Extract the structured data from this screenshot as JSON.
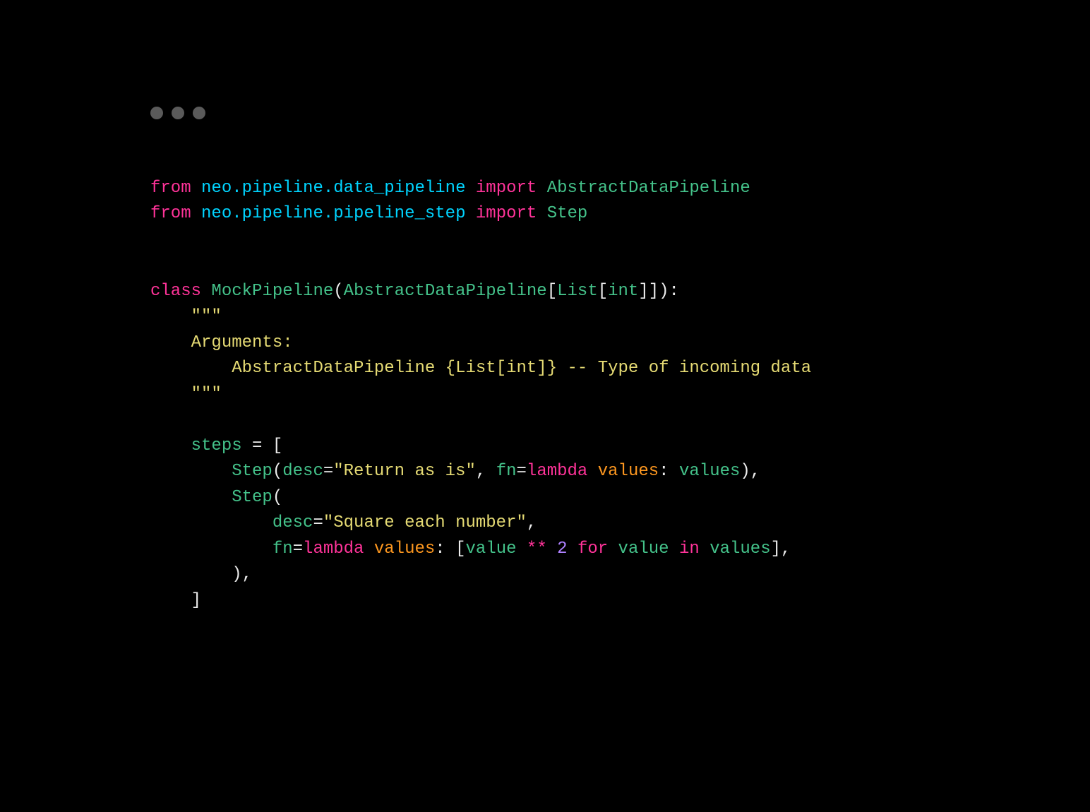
{
  "code": {
    "line1": {
      "from": "from",
      "module": "neo.pipeline.data_pipeline",
      "import": "import",
      "name": "AbstractDataPipeline"
    },
    "line2": {
      "from": "from",
      "module": "neo.pipeline.pipeline_step",
      "import": "import",
      "name": "Step"
    },
    "line5": {
      "class": "class",
      "name": "MockPipeline",
      "open": "(",
      "base": "AbstractDataPipeline",
      "bracket_open": "[",
      "generic": "List",
      "inner_open": "[",
      "type": "int",
      "inner_close": "]",
      "bracket_close": "]",
      "close": "):"
    },
    "docstring": {
      "open": "    \"\"\"",
      "arg_header": "    Arguments:",
      "arg_line": "        AbstractDataPipeline {List[int]} -- Type of incoming data",
      "close": "    \"\"\""
    },
    "steps_open": {
      "var": "steps",
      "eq": " = [",
      "indent": "    "
    },
    "step1": {
      "indent": "        ",
      "name": "Step",
      "open": "(",
      "desc_kw": "desc",
      "eq1": "=",
      "desc_val": "\"Return as is\"",
      "comma1": ", ",
      "fn_kw": "fn",
      "eq2": "=",
      "lambda": "lambda",
      "param": "values",
      "colon": ": ",
      "body": "values",
      "close": "),"
    },
    "step2": {
      "line1_indent": "        ",
      "line1_name": "Step",
      "line1_open": "(",
      "line2_indent": "            ",
      "line2_desc_kw": "desc",
      "line2_eq": "=",
      "line2_val": "\"Square each number\"",
      "line2_comma": ",",
      "line3_indent": "            ",
      "line3_fn_kw": "fn",
      "line3_eq": "=",
      "line3_lambda": "lambda",
      "line3_param": "values",
      "line3_colon": ": [",
      "line3_value": "value",
      "line3_op": " ** ",
      "line3_num": "2",
      "line3_for": " for",
      "line3_iter": " value",
      "line3_in": " in",
      "line3_src": " values",
      "line3_close": "],",
      "line4_indent": "        ",
      "line4_close": "),"
    },
    "steps_close": {
      "indent": "    ",
      "bracket": "]"
    }
  }
}
